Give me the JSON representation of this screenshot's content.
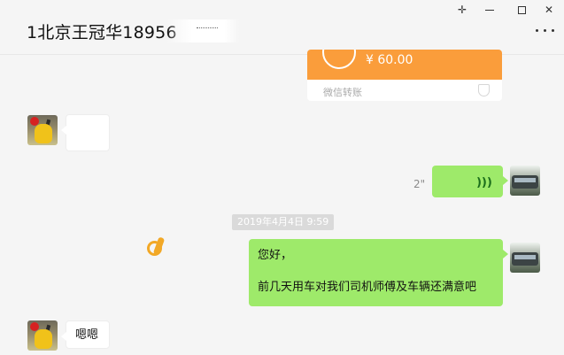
{
  "window": {
    "title": "1北京王冠华18956"
  },
  "messages": {
    "transfer": {
      "amount": "¥ 60.00",
      "label": "微信转账"
    },
    "voice": {
      "duration": "2\"",
      "icon": "((("
    },
    "timestamp": "2019年4月4日 9:59",
    "greeting": {
      "line1": "您好，",
      "line2": "前几天用车对我们司机师傅及车辆还满意吧"
    },
    "reply": "嗯嗯"
  },
  "icons": {
    "pin": "pin-icon",
    "minimize": "minimize-icon",
    "maximize": "maximize-icon",
    "close": "close-icon",
    "more": "more-icon",
    "ok_hand": "ok-hand-emoji"
  },
  "colors": {
    "sent_bubble": "#9eea6a",
    "transfer_orange": "#fa9d3b",
    "background": "#f5f5f5"
  }
}
